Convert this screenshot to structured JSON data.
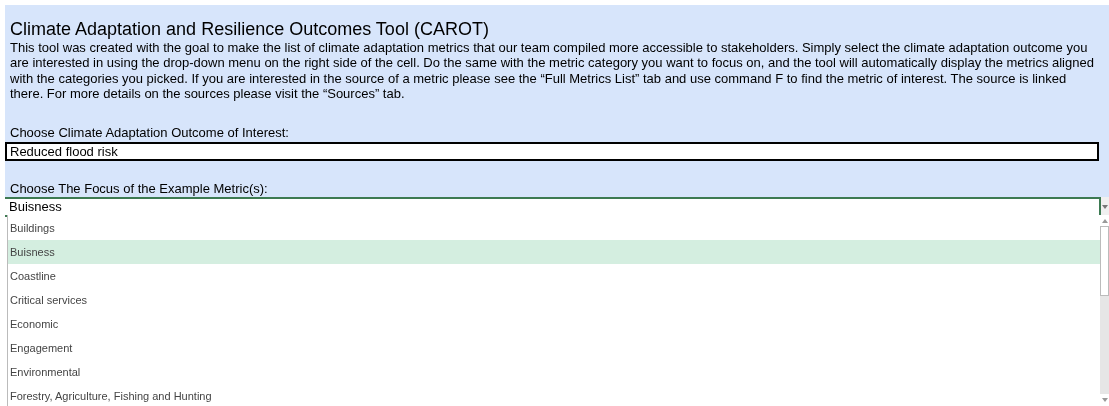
{
  "title": "Climate Adaptation and Resilience Outcomes Tool (CAROT)",
  "description": "This tool was created with the goal to make the list of climate adaptation metrics that our team compiled more accessible to stakeholders. Simply select the climate adaptation outcome you are interested in using the drop-down menu on the right side of the cell. Do the same with the metric category you want to focus on, and the tool will automatically display the metrics aligned with the categories you picked. If you are interested in the source of a metric please see the “Full Metrics List” tab and use command F to find the metric of interest. The source is linked there. For more details on the sources please visit the “Sources” tab.",
  "outcome": {
    "label": "Choose Climate Adaptation Outcome of Interest:",
    "value": "Reduced flood risk"
  },
  "focus": {
    "label": "Choose The Focus of the Example Metric(s):",
    "value": "Buisness"
  },
  "dropdown": {
    "options": [
      {
        "label": "Buildings",
        "selected": false
      },
      {
        "label": "Buisness",
        "selected": true
      },
      {
        "label": "Coastline",
        "selected": false
      },
      {
        "label": "Critical services",
        "selected": false
      },
      {
        "label": "Economic",
        "selected": false
      },
      {
        "label": "Engagement",
        "selected": false
      },
      {
        "label": "Environmental",
        "selected": false
      },
      {
        "label": "Forestry, Agriculture, Fishing and Hunting",
        "selected": false
      }
    ]
  }
}
